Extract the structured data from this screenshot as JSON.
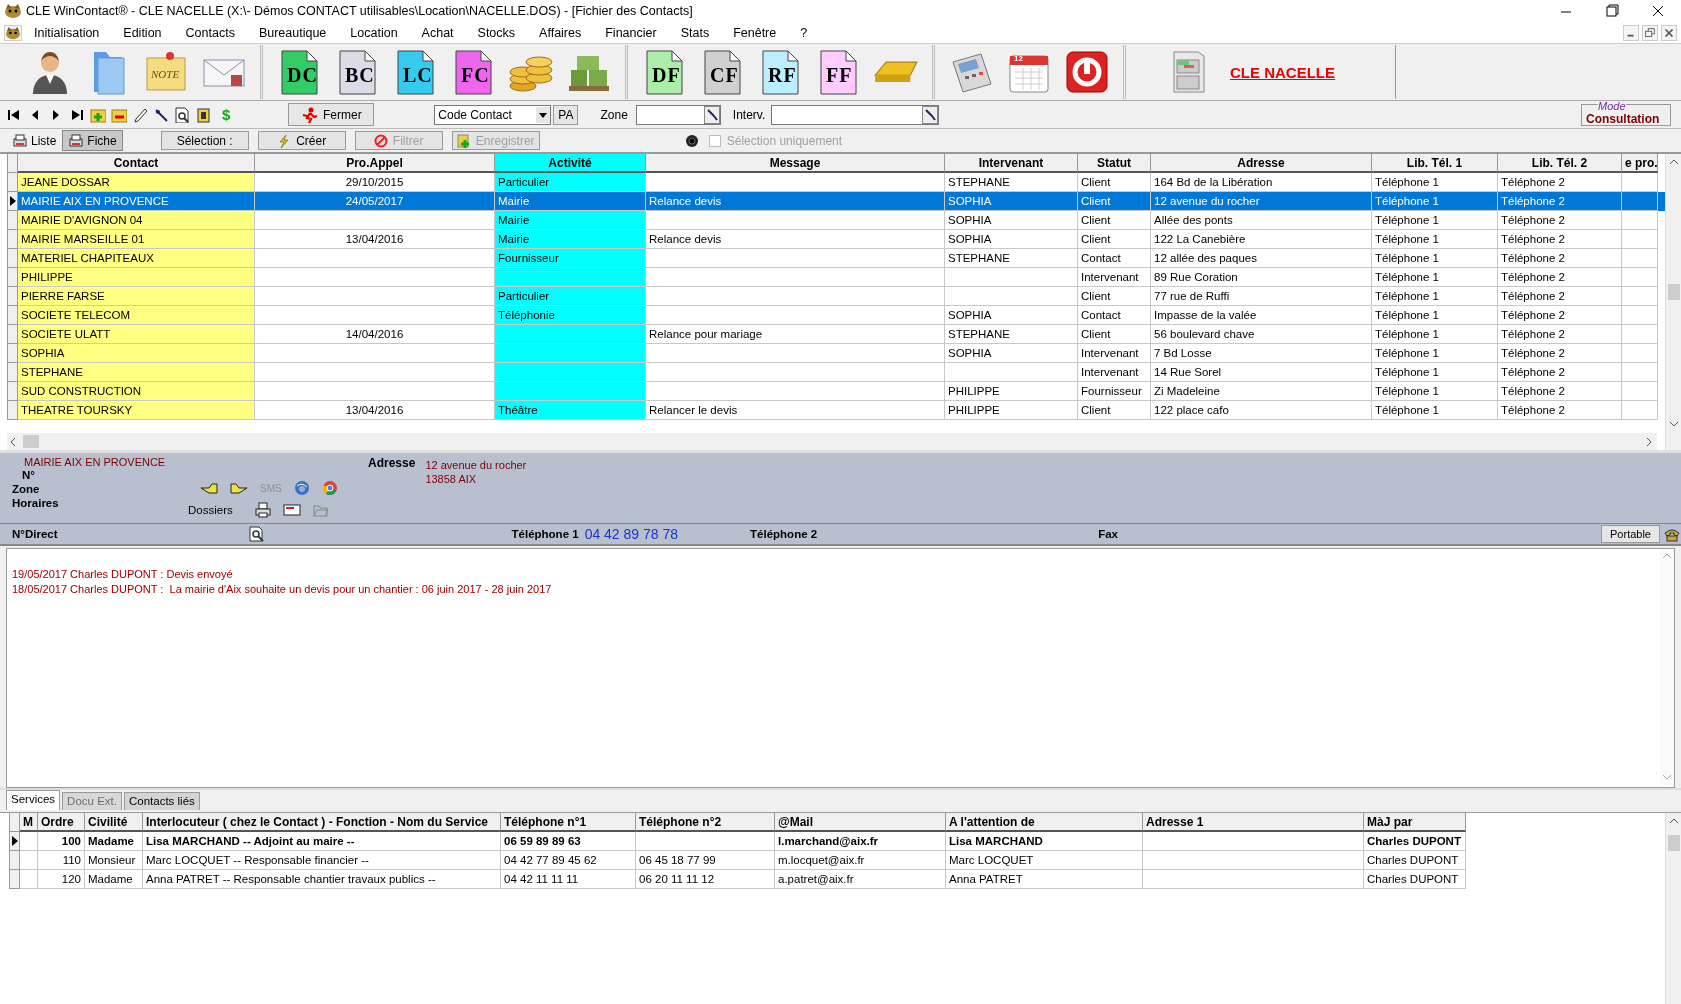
{
  "window": {
    "title": "CLE WinContact® - CLE NACELLE (X:\\- Démos CONTACT utilisables\\Location\\NACELLE.DOS) - [Fichier des Contacts]"
  },
  "menu": {
    "items": [
      "Initialisation",
      "Edition",
      "Contacts",
      "Bureautique",
      "Location",
      "Achat",
      "Stocks",
      "Affaires",
      "Financier",
      "Stats",
      "Fenêtre",
      "?"
    ]
  },
  "toolbar": {
    "groups": [
      {
        "items": [
          {
            "kind": "person"
          },
          {
            "kind": "folder"
          },
          {
            "kind": "note",
            "label": "NOTE"
          },
          {
            "kind": "mail"
          }
        ]
      },
      {
        "items": [
          {
            "kind": "doc",
            "label": "DC",
            "color": "#33cc66"
          },
          {
            "kind": "doc",
            "label": "BC",
            "color": "#dcdce8"
          },
          {
            "kind": "doc",
            "label": "LC",
            "color": "#33ccee"
          },
          {
            "kind": "doc",
            "label": "FC",
            "color": "#ee66ee"
          },
          {
            "kind": "coins"
          },
          {
            "kind": "boxes"
          }
        ]
      },
      {
        "items": [
          {
            "kind": "doc",
            "label": "DF",
            "color": "#aaeeaa"
          },
          {
            "kind": "doc",
            "label": "CF",
            "color": "#d0d0d0"
          },
          {
            "kind": "doc",
            "label": "RF",
            "color": "#bbeeff"
          },
          {
            "kind": "doc",
            "label": "FF",
            "color": "#ffccff"
          },
          {
            "kind": "gold"
          }
        ]
      },
      {
        "items": [
          {
            "kind": "calculator"
          },
          {
            "kind": "calendar",
            "label": "12"
          },
          {
            "kind": "power"
          }
        ]
      },
      {
        "items": [
          {
            "kind": "cabinet"
          }
        ]
      }
    ],
    "link": "CLE NACELLE"
  },
  "navbar": {
    "currency_symbol": "$",
    "close_button": "Fermer",
    "sort_select": "Code Contact",
    "pa_button": "PA",
    "zone_label": "Zone",
    "interv_label": "Interv.",
    "mode": {
      "legend": "Mode",
      "value": "Consultation"
    }
  },
  "view_tabs": [
    {
      "label": "Liste",
      "selected": true
    },
    {
      "label": "Fiche",
      "selected": false
    }
  ],
  "actions": [
    {
      "kind": "plain",
      "label": "Sélection :",
      "disabled": false
    },
    {
      "kind": "create",
      "label": "Créer",
      "disabled": false
    },
    {
      "kind": "filter",
      "label": "Filtrer",
      "disabled": true
    },
    {
      "kind": "save",
      "label": "Enregistrer",
      "disabled": true
    }
  ],
  "selection_only": {
    "label": "Sélection uniquement",
    "checked": false,
    "disabled": true
  },
  "table": {
    "columns": [
      {
        "label": "Contact",
        "color": "#ffff80",
        "highlighted": false
      },
      {
        "label": "Pro.Appel",
        "highlighted": false
      },
      {
        "label": "Activité",
        "color": "#00ffff",
        "highlighted": true
      },
      {
        "label": "Message",
        "highlighted": false
      },
      {
        "label": "Intervenant",
        "highlighted": false
      },
      {
        "label": "Statut",
        "highlighted": false
      },
      {
        "label": "Adresse",
        "highlighted": false
      },
      {
        "label": "Lib. Tél. 1",
        "highlighted": false
      },
      {
        "label": "Lib. Tél. 2",
        "highlighted": false
      },
      {
        "label": "e pro.",
        "highlighted": false
      }
    ],
    "rows": [
      {
        "selected": false,
        "cells": [
          "JEANE DOSSAR",
          "29/10/2015",
          "Particulier",
          null,
          "STEPHANE",
          "Client",
          "164 Bd de la Libération",
          "Téléphone 1",
          "Téléphone 2",
          null
        ]
      },
      {
        "selected": true,
        "cells": [
          "MAIRIE AIX EN PROVENCE",
          "24/05/2017",
          "Mairie",
          "Relance devis",
          "SOPHIA",
          "Client",
          "12 avenue du rocher",
          "Téléphone 1",
          "Téléphone 2",
          null
        ]
      },
      {
        "selected": false,
        "cells": [
          "MAIRIE D'AVIGNON 04",
          null,
          "Mairie",
          null,
          "SOPHIA",
          "Client",
          "Allée des ponts",
          "Téléphone 1",
          "Téléphone 2",
          null
        ]
      },
      {
        "selected": false,
        "cells": [
          "MAIRIE MARSEILLE 01",
          "13/04/2016",
          "Mairie",
          "Relance devis",
          "SOPHIA",
          "Client",
          "122 La Canebière",
          "Téléphone 1",
          "Téléphone 2",
          null
        ]
      },
      {
        "selected": false,
        "cells": [
          "MATERIEL CHAPITEAUX",
          null,
          "Fournisseur",
          null,
          "STEPHANE",
          "Contact",
          "12 allée des paques",
          "Téléphone 1",
          "Téléphone 2",
          null
        ]
      },
      {
        "selected": false,
        "cells": [
          "PHILIPPE",
          null,
          null,
          null,
          null,
          "Intervenant",
          "89 Rue Coration",
          "Téléphone 1",
          "Téléphone 2",
          null
        ]
      },
      {
        "selected": false,
        "cells": [
          "PIERRE FARSE",
          null,
          "Particulier",
          null,
          null,
          "Client",
          "77 rue de Ruffi",
          "Téléphone 1",
          "Téléphone 2",
          null
        ]
      },
      {
        "selected": false,
        "cells": [
          "SOCIETE TELECOM",
          null,
          "Téléphonie",
          null,
          "SOPHIA",
          "Contact",
          "Impasse de la valée",
          "Téléphone 1",
          "Téléphone 2",
          null
        ]
      },
      {
        "selected": false,
        "cells": [
          "SOCIETE ULATT",
          "14/04/2016",
          null,
          "Relance pour mariage",
          "STEPHANE",
          "Client",
          "56 boulevard chave",
          "Téléphone 1",
          "Téléphone 2",
          null
        ]
      },
      {
        "selected": false,
        "cells": [
          "SOPHIA",
          null,
          null,
          null,
          "SOPHIA",
          "Intervenant",
          "7 Bd Losse",
          "Téléphone 1",
          "Téléphone 2",
          null
        ]
      },
      {
        "selected": false,
        "cells": [
          "STEPHANE",
          null,
          null,
          null,
          null,
          "Intervenant",
          "14 Rue Sorel",
          "Téléphone 1",
          "Téléphone 2",
          null
        ]
      },
      {
        "selected": false,
        "cells": [
          "SUD CONSTRUCTION",
          null,
          null,
          null,
          "PHILIPPE",
          "Fournisseur",
          "Zi Madeleine",
          "Téléphone 1",
          "Téléphone 2",
          null
        ]
      },
      {
        "selected": false,
        "cells": [
          "THEATRE TOURSKY",
          "13/04/2016",
          "Théâtre",
          "Relancer le devis",
          "PHILIPPE",
          "Client",
          "122 place cafo",
          "Téléphone 1",
          "Téléphone 2",
          null
        ]
      }
    ]
  },
  "detail": {
    "name": "MAIRIE AIX EN PROVENCE",
    "labels": [
      "N°",
      "Zone",
      "Horaires"
    ],
    "sms": {
      "label": "SMS",
      "disabled": true
    },
    "dossiers_label": "Dossiers",
    "address_label": "Adresse",
    "address_lines": [
      "12 avenue du rocher",
      "13858 AIX"
    ]
  },
  "phone_bar": {
    "direct_label": "N°Direct",
    "phone1_label": "Téléphone 1",
    "phone1": "04 42 89 78 78",
    "phone2_label": "Téléphone 2",
    "fax_label": "Fax",
    "portable_button": "Portable"
  },
  "notes": [
    "19/05/2017 Charles DUPONT : Devis envoyé",
    "18/05/2017 Charles DUPONT :  La mairie d'Aix souhaite un devis pour un chantier : 06 juin 2017 - 28 juin 2017"
  ],
  "bottom_tabs": [
    {
      "label": "Services",
      "selected": true,
      "disabled": false
    },
    {
      "label": "Docu Ext.",
      "selected": false,
      "disabled": true
    },
    {
      "label": "Contacts liés",
      "selected": false,
      "disabled": false
    }
  ],
  "services": {
    "columns": [
      {
        "label": "M"
      },
      {
        "label": "Ordre"
      },
      {
        "label": "Civilité"
      },
      {
        "label": "Interlocuteur ( chez le Contact ) - Fonction - Nom du Service"
      },
      {
        "label": "Téléphone n°1"
      },
      {
        "label": "Téléphone n°2"
      },
      {
        "label": "@Mail"
      },
      {
        "label": "A l'attention de"
      },
      {
        "label": "Adresse 1"
      },
      {
        "label": "MàJ par"
      }
    ],
    "rows": [
      {
        "selected": true,
        "cells": [
          null,
          "100",
          "Madame",
          "Lisa MARCHAND -- Adjoint au maire --",
          "06 59 89 89 63",
          null,
          "l.marchand@aix.fr",
          "Lisa MARCHAND",
          null,
          "Charles DUPONT"
        ]
      },
      {
        "selected": false,
        "cells": [
          null,
          "110",
          "Monsieur",
          "Marc LOCQUET -- Responsable financier --",
          "04 42 77 89 45 62",
          "06 45 18 77 99",
          "m.locquet@aix.fr",
          "Marc LOCQUET",
          null,
          "Charles DUPONT"
        ]
      },
      {
        "selected": false,
        "cells": [
          null,
          "120",
          "Madame",
          "Anna PATRET -- Responsable chantier travaux publics --",
          "04 42 11 11 11",
          "06 20 11 11 12",
          "a.patret@aix.fr",
          "Anna PATRET",
          null,
          "Charles DUPONT"
        ]
      }
    ]
  }
}
